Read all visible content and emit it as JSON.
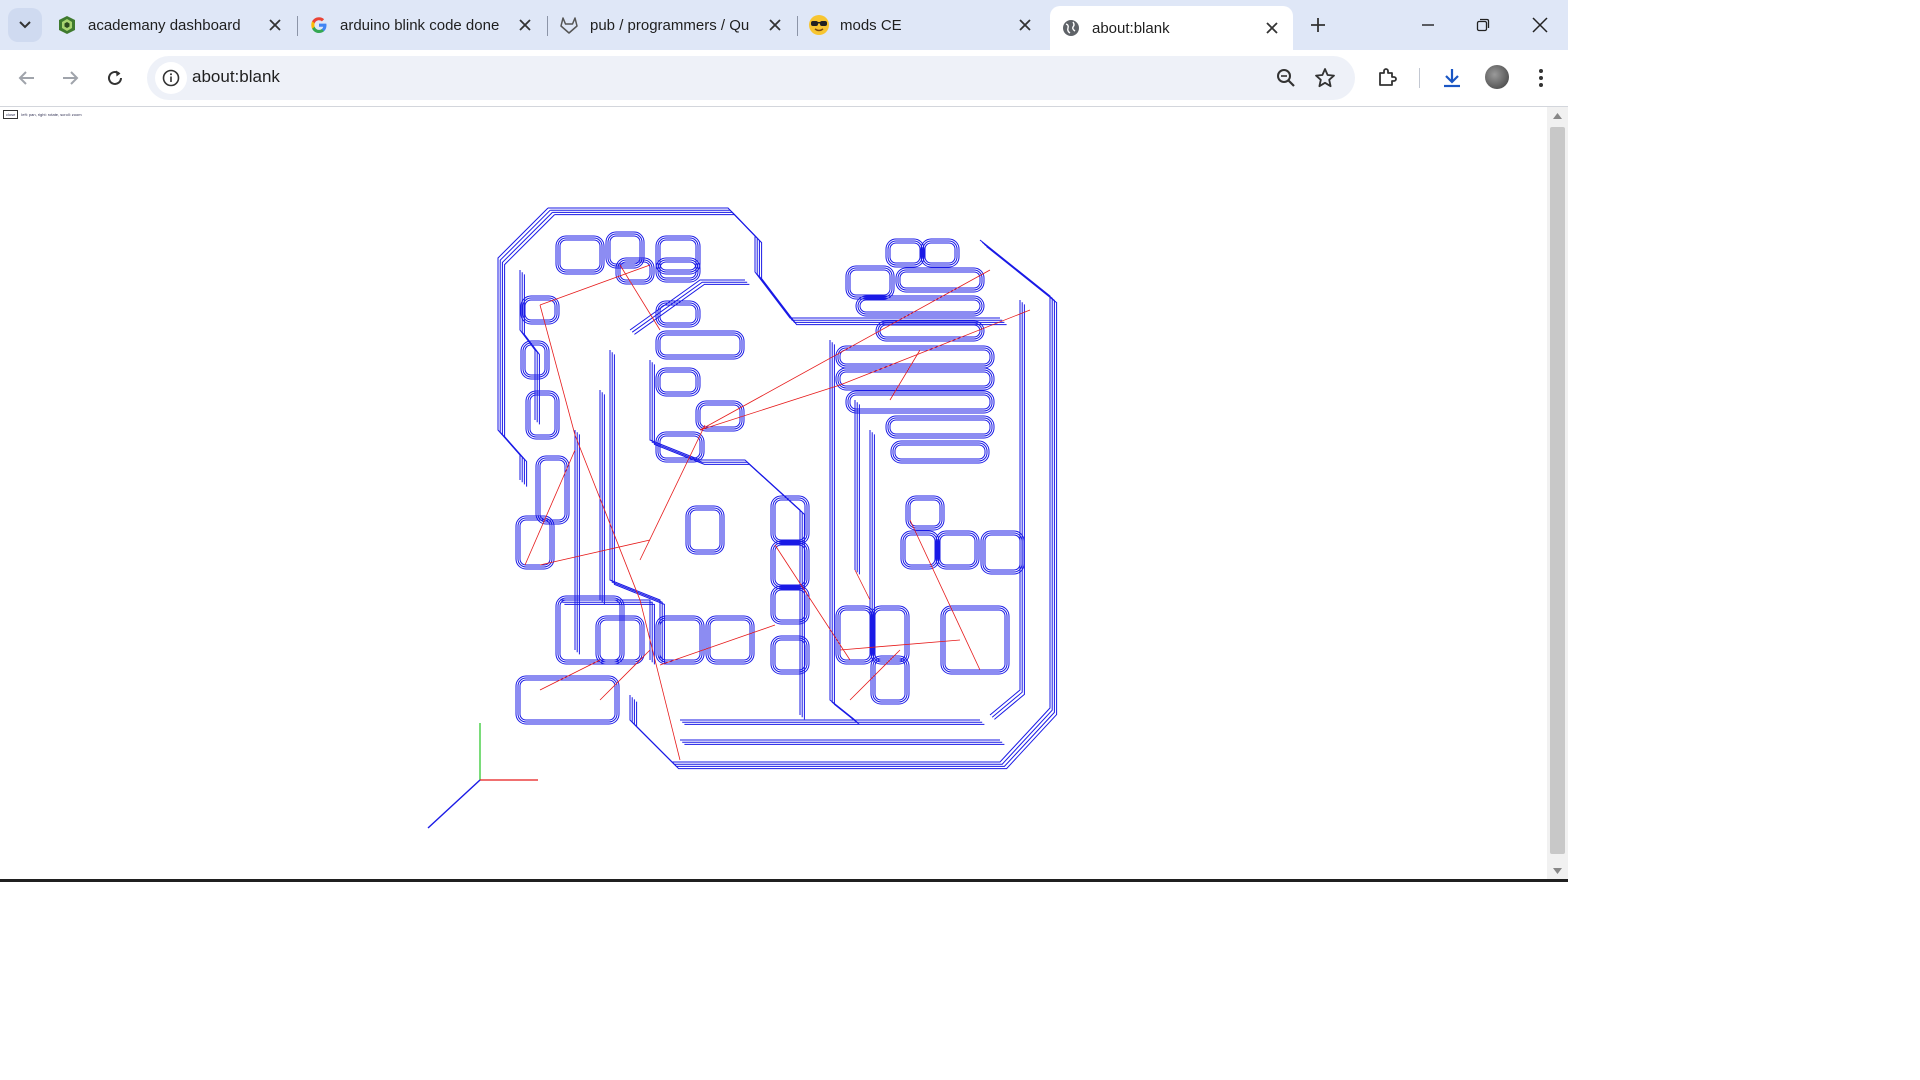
{
  "tabs": [
    {
      "title": "academany dashboard",
      "icon": "academany-icon"
    },
    {
      "title": "arduino blink code done",
      "icon": "google-icon"
    },
    {
      "title": "pub / programmers / Qu",
      "icon": "gitlab-icon"
    },
    {
      "title": "mods CE",
      "icon": "sunglasses-emoji-icon"
    },
    {
      "title": "about:blank",
      "icon": "globe-icon"
    }
  ],
  "address": {
    "url": "about:blank"
  },
  "viewer": {
    "close_label": "close",
    "hint": "left: pan, right: rotate, scroll: zoom"
  },
  "colors": {
    "toolpath": "#1a1ae6",
    "rapid_move": "#e61a1a",
    "tabbar": "#dfe7f7",
    "x_axis": "#e61a1a",
    "y_axis": "#22c422",
    "z_axis": "#1a1ae6"
  }
}
